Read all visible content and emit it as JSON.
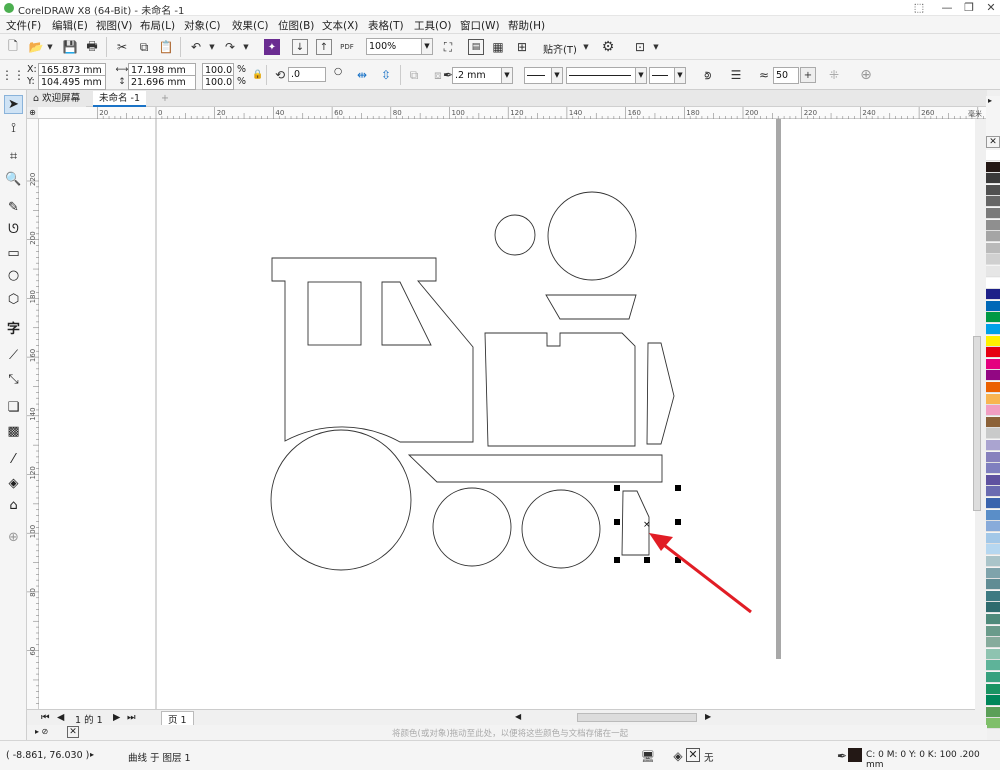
{
  "window": {
    "title": "CorelDRAW X8 (64-Bit) - 未命名 -1"
  },
  "menu": [
    "文件(F)",
    "编辑(E)",
    "视图(V)",
    "布局(L)",
    "对象(C)",
    "效果(C)",
    "位图(B)",
    "文本(X)",
    "表格(T)",
    "工具(O)",
    "窗口(W)",
    "帮助(H)"
  ],
  "toolbar": {
    "zoom": "100%",
    "snap_label": "贴齐(T)",
    "pdf_label": "PDF"
  },
  "props": {
    "x_label": "X:",
    "x": "165.873 mm",
    "y_label": "Y:",
    "y": "104.495 mm",
    "w": "17.198 mm",
    "h": "21.696 mm",
    "sx": "100.0",
    "sy": "100.0",
    "pct": "%",
    "rotation": ".0",
    "outline": ".2 mm",
    "smooth": "50"
  },
  "tabs": {
    "welcome": "欢迎屏幕",
    "doc": "未命名 -1"
  },
  "ruler": {
    "h_ticks": [
      "20",
      "0",
      "20",
      "40",
      "60",
      "80",
      "100",
      "120",
      "140",
      "160",
      "180",
      "200",
      "220",
      "240",
      "260"
    ],
    "v_ticks": [
      "220",
      "200",
      "180",
      "160",
      "140",
      "120",
      "100",
      "80",
      "60"
    ],
    "unit": "毫米"
  },
  "pagebar": {
    "page_count": "1 的 1",
    "page_tab": "页 1"
  },
  "hint": "将颜色(或对象)拖动至此处，以便将这些颜色与文档存储在一起",
  "status": {
    "coords": "( -8.861, 76.030 )",
    "object_info": "曲线 于 图层 1",
    "fill": "无",
    "outline_info": "C: 0 M: 0 Y: 0 K: 100 .200 mm"
  },
  "colors": {
    "accent_red": "#e11d25",
    "palette": [
      "#ffffff",
      "#231815",
      "#3a3a3a",
      "#505050",
      "#666666",
      "#7a7a7a",
      "#8f8f8f",
      "#a5a5a5",
      "#bababa",
      "#d0d0d0",
      "#e6e6e6",
      "#ffffff",
      "#1d2088",
      "#0068b7",
      "#009944",
      "#00a0e9",
      "#fff100",
      "#e60012",
      "#e4007f",
      "#920783",
      "#eb6100",
      "#f8b551",
      "#f19ec2",
      "#8c6239",
      "#c9caca",
      "#aaa4d0",
      "#8781bd",
      "#7f7fbf",
      "#5f52a0",
      "#6a6bb1",
      "#3a64ad",
      "#5a8ec8",
      "#88abda",
      "#a3c8e8",
      "#b6d7f0",
      "#aac4c9",
      "#7fa3ab",
      "#608c94",
      "#3d7a82",
      "#2f6b6e",
      "#4f8a7b",
      "#6a9b8b",
      "#86ab9c",
      "#8ec3b0",
      "#5eb399",
      "#38a17f",
      "#1a9463",
      "#00875a",
      "#5b9f58",
      "#7fbf6a"
    ]
  }
}
